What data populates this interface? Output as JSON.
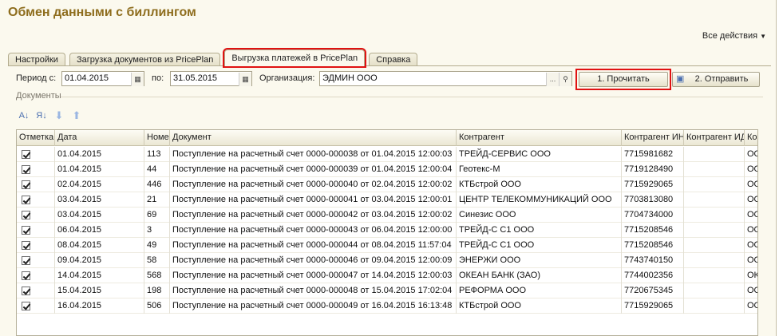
{
  "window": {
    "title": "Обмен данными с биллингом",
    "all_actions": "Все действия"
  },
  "tabs": [
    {
      "label": "Настройки"
    },
    {
      "label": "Загрузка документов из PricePlan"
    },
    {
      "label": "Выгрузка платежей в PricePlan",
      "active": true
    },
    {
      "label": "Справка"
    }
  ],
  "filters": {
    "period_label": "Период с:",
    "date_from": "01.04.2015",
    "to_label": "по:",
    "date_to": "31.05.2015",
    "org_label": "Организация:",
    "org_value": "ЭДМИН ООО",
    "ellipsis": "...",
    "read_button": "1. Прочитать",
    "send_button": "2. Отправить"
  },
  "documents_group": "Документы",
  "table": {
    "columns": [
      "Отметка",
      "Дата",
      "Номер",
      "Документ",
      "Контрагент",
      "Контрагент ИНН",
      "Контрагент ИД",
      "Контрагент"
    ],
    "rows": [
      {
        "date": "01.04.2015",
        "num": "113",
        "doc": "Поступление на расчетный счет 0000-000038 от 01.04.2015 12:00:03",
        "contractor": "ТРЕЙД-СЕРВИС ООО",
        "inn": "7715981682",
        "id": "",
        "extra": "ООО"
      },
      {
        "date": "01.04.2015",
        "num": "44",
        "doc": "Поступление на расчетный счет 0000-000039 от 01.04.2015 12:00:04",
        "contractor": "Геотекс-М",
        "inn": "7719128490",
        "id": "",
        "extra": "ООО"
      },
      {
        "date": "02.04.2015",
        "num": "446",
        "doc": "Поступление на расчетный счет 0000-000040 от 02.04.2015 12:00:02",
        "contractor": "КТБстрой ООО",
        "inn": "7715929065",
        "id": "",
        "extra": "ООО"
      },
      {
        "date": "03.04.2015",
        "num": "21",
        "doc": "Поступление на расчетный счет 0000-000041 от 03.04.2015 12:00:01",
        "contractor": "ЦЕНТР ТЕЛЕКОММУНИКАЦИЙ ООО",
        "inn": "7703813080",
        "id": "",
        "extra": "ООО"
      },
      {
        "date": "03.04.2015",
        "num": "69",
        "doc": "Поступление на расчетный счет 0000-000042 от 03.04.2015 12:00:02",
        "contractor": "Синезис ООО",
        "inn": "7704734000",
        "id": "",
        "extra": "ООО"
      },
      {
        "date": "06.04.2015",
        "num": "3",
        "doc": "Поступление на расчетный счет 0000-000043 от 06.04.2015 12:00:00",
        "contractor": "ТРЕЙД-С С1 ООО",
        "inn": "7715208546",
        "id": "",
        "extra": "ООО"
      },
      {
        "date": "08.04.2015",
        "num": "49",
        "doc": "Поступление на расчетный счет 0000-000044 от 08.04.2015 11:57:04",
        "contractor": "ТРЕЙД-С С1 ООО",
        "inn": "7715208546",
        "id": "",
        "extra": "ООО"
      },
      {
        "date": "09.04.2015",
        "num": "58",
        "doc": "Поступление на расчетный счет 0000-000046 от 09.04.2015 12:00:09",
        "contractor": "ЭНЕРЖИ ООО",
        "inn": "7743740150",
        "id": "",
        "extra": "ООО"
      },
      {
        "date": "14.04.2015",
        "num": "568",
        "doc": "Поступление на расчетный счет 0000-000047 от 14.04.2015 12:00:03",
        "contractor": "ОКЕАН БАНК (ЗАО)",
        "inn": "7744002356",
        "id": "",
        "extra": "ОКЕ"
      },
      {
        "date": "15.04.2015",
        "num": "198",
        "doc": "Поступление на расчетный счет 0000-000048 от 15.04.2015 17:02:04",
        "contractor": "РЕФОРМА ООО",
        "inn": "7720675345",
        "id": "",
        "extra": "ООО"
      },
      {
        "date": "16.04.2015",
        "num": "506",
        "doc": "Поступление на расчетный счет 0000-000049 от 16.04.2015 16:13:48",
        "contractor": "КТБстрой ООО",
        "inn": "7715929065",
        "id": "",
        "extra": "ООО"
      }
    ]
  },
  "icons": {
    "sort_asc": "sort-ascending-icon",
    "sort_desc": "sort-descending-icon",
    "move_down": "arrow-down-icon",
    "move_up": "arrow-up-icon",
    "calendar": "calendar-icon",
    "search": "search-icon",
    "floppy": "floppy-disk-icon"
  },
  "colors": {
    "title": "#8e6d1d",
    "highlight": "#e01212",
    "background": "#fbf9ee"
  }
}
